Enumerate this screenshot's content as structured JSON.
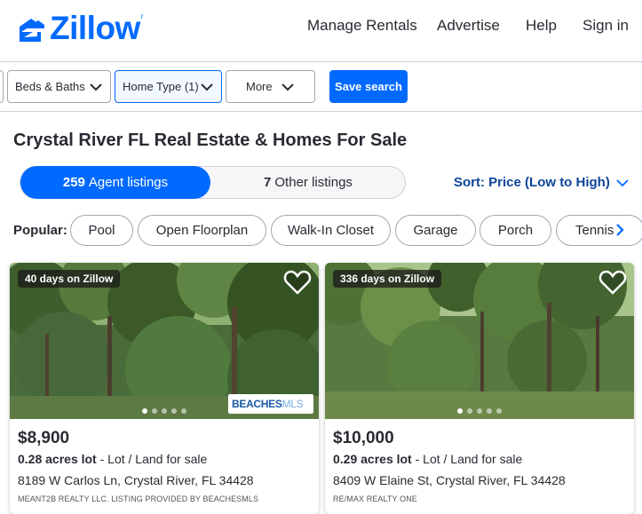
{
  "header": {
    "logo_text": "Zillow",
    "logo_mark": "r",
    "nav": [
      "Manage Rentals",
      "Advertise",
      "Help",
      "Sign in"
    ]
  },
  "filters": {
    "beds_baths": "Beds & Baths",
    "home_type": "Home Type (1)",
    "more": "More",
    "save_search": "Save search"
  },
  "page_title": "Crystal River FL Real Estate & Homes For Sale",
  "tabs": {
    "agent_count": "259",
    "agent_label": "Agent listings",
    "other_count": "7",
    "other_label": "Other listings"
  },
  "sort": {
    "label": "Sort:",
    "value": "Price (Low to High)"
  },
  "popular": {
    "label": "Popular:",
    "chips": [
      "Pool",
      "Open Floorplan",
      "Walk-In Closet",
      "Garage",
      "Porch",
      "Tennis"
    ]
  },
  "listings": [
    {
      "badge": "40 days on Zillow",
      "price": "$8,900",
      "size": "0.28 acres lot",
      "type": " - Lot / Land for sale",
      "address": "8189 W Carlos Ln, Crystal River, FL 34428",
      "broker": "MEANT2B REALTY LLC. Listing provided by BeachesMLS",
      "mls_logo_bold": "BEACHES",
      "mls_logo_light": "MLS",
      "photo_dots": 5,
      "photo_active": 0
    },
    {
      "badge": "336 days on Zillow",
      "price": "$10,000",
      "size": "0.29 acres lot",
      "type": " - Lot / Land for sale",
      "address": "8409 W Elaine St, Crystal River, FL 34428",
      "broker": "RE/MAX REALTY ONE",
      "photo_dots": 5,
      "photo_active": 0
    }
  ],
  "colors": {
    "brand": "#006aff",
    "text": "#2a2a33",
    "sort": "#0d4599"
  }
}
